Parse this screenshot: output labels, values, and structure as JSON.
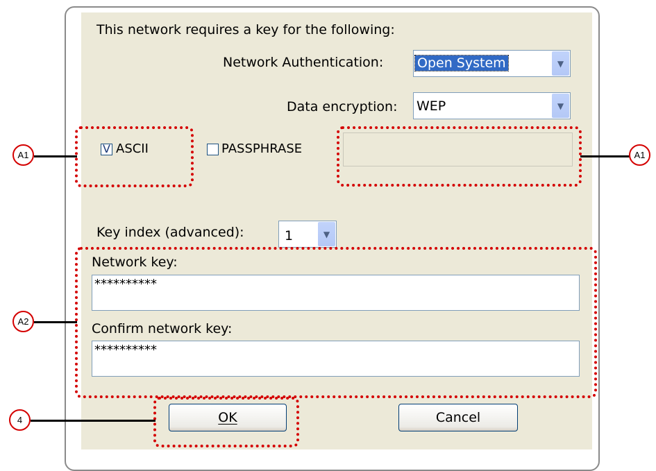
{
  "dialog": {
    "intro": "This network requires a key for the following:",
    "auth_label": "Network Authentication:",
    "auth_value": "Open System",
    "enc_label": "Data encryption:",
    "enc_value": "WEP",
    "ascii_label": "ASCII",
    "ascii_checked": true,
    "ascii_mark": "V",
    "passphrase_label": "PASSPHRASE",
    "passphrase_checked": false,
    "key_index_label": "Key index (advanced):",
    "key_index_value": "1",
    "network_key_label": "Network key:",
    "network_key_value": "**********",
    "confirm_key_label": "Confirm network key:",
    "confirm_key_value": "**********",
    "ok_label": "OK",
    "cancel_label": "Cancel",
    "dropdown_arrow": "chevron-down-icon"
  },
  "callouts": {
    "a1_left": "A1",
    "a1_right": "A1",
    "a2": "A2",
    "four": "4"
  },
  "colors": {
    "highlight": "#d40000",
    "dialog_bg": "#ece9d8",
    "selection": "#316ac5"
  }
}
